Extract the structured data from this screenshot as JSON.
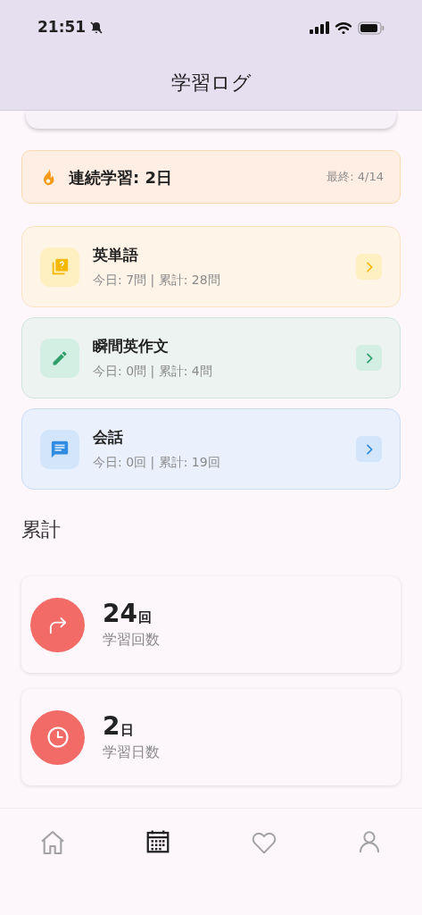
{
  "status_bar": {
    "time": "21:51",
    "silent": true
  },
  "header": {
    "title": "学習ログ"
  },
  "streak": {
    "label": "連続学習: 2日",
    "last": "最終: 4/14"
  },
  "categories": [
    {
      "kind": "vocab",
      "title": "英単語",
      "stats": "今日: 7問 | 累計: 28問",
      "color": "#f5b800"
    },
    {
      "kind": "writing",
      "title": "瞬間英作文",
      "stats": "今日: 0問 | 累計: 4問",
      "color": "#2e9e6b"
    },
    {
      "kind": "conversation",
      "title": "会話",
      "stats": "今日: 0回 | 累計: 19回",
      "color": "#2f8ce0"
    }
  ],
  "totals_heading": "累計",
  "totals": [
    {
      "kind": "sessions",
      "value": "24",
      "unit": "回",
      "label": "学習回数"
    },
    {
      "kind": "days",
      "value": "2",
      "unit": "日",
      "label": "学習日数"
    }
  ],
  "nav": [
    {
      "kind": "home",
      "selected": false
    },
    {
      "kind": "calendar",
      "selected": true
    },
    {
      "kind": "favorites",
      "selected": false
    },
    {
      "kind": "profile",
      "selected": false
    }
  ]
}
